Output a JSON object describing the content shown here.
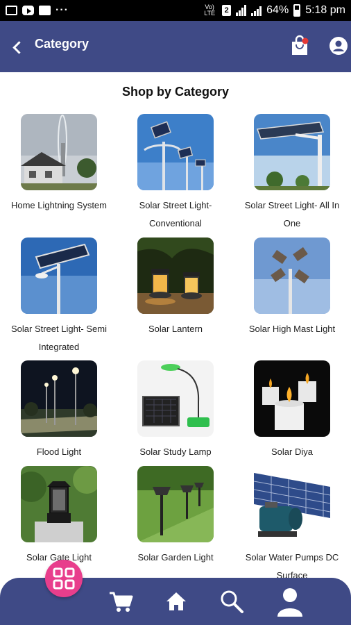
{
  "status_bar": {
    "network_label": "Vo) LTE",
    "sim_slot": "2",
    "battery_percent": "64%",
    "time": "5:18 pm"
  },
  "header": {
    "title": "Category"
  },
  "section_title": "Shop by Category",
  "categories": [
    {
      "label": "Home Lightning System",
      "icon": "lightning-rod-house"
    },
    {
      "label": "Solar Street Light- Conventional",
      "icon": "solar-street-light"
    },
    {
      "label": "Solar Street Light- All In One",
      "icon": "all-in-one-street-light"
    },
    {
      "label": "Solar Street Light- Semi Integrated",
      "icon": "semi-integrated-street-light"
    },
    {
      "label": "Solar Lantern",
      "icon": "solar-lantern"
    },
    {
      "label": "Solar High Mast Light",
      "icon": "high-mast-light"
    },
    {
      "label": "Flood Light",
      "icon": "flood-light"
    },
    {
      "label": "Solar Study Lamp",
      "icon": "study-lamp"
    },
    {
      "label": "Solar Diya",
      "icon": "solar-diya"
    },
    {
      "label": "Solar Gate Light",
      "icon": "gate-light"
    },
    {
      "label": "Solar Garden Light",
      "icon": "garden-light"
    },
    {
      "label": "Solar Water Pumps DC Surface",
      "icon": "water-pump"
    }
  ],
  "bottom_nav": {
    "items": [
      "grid-menu-icon",
      "cart-icon",
      "home-icon",
      "search-icon",
      "account-icon"
    ]
  },
  "colors": {
    "primary": "#3f4a86",
    "accent": "#e83e8c"
  }
}
